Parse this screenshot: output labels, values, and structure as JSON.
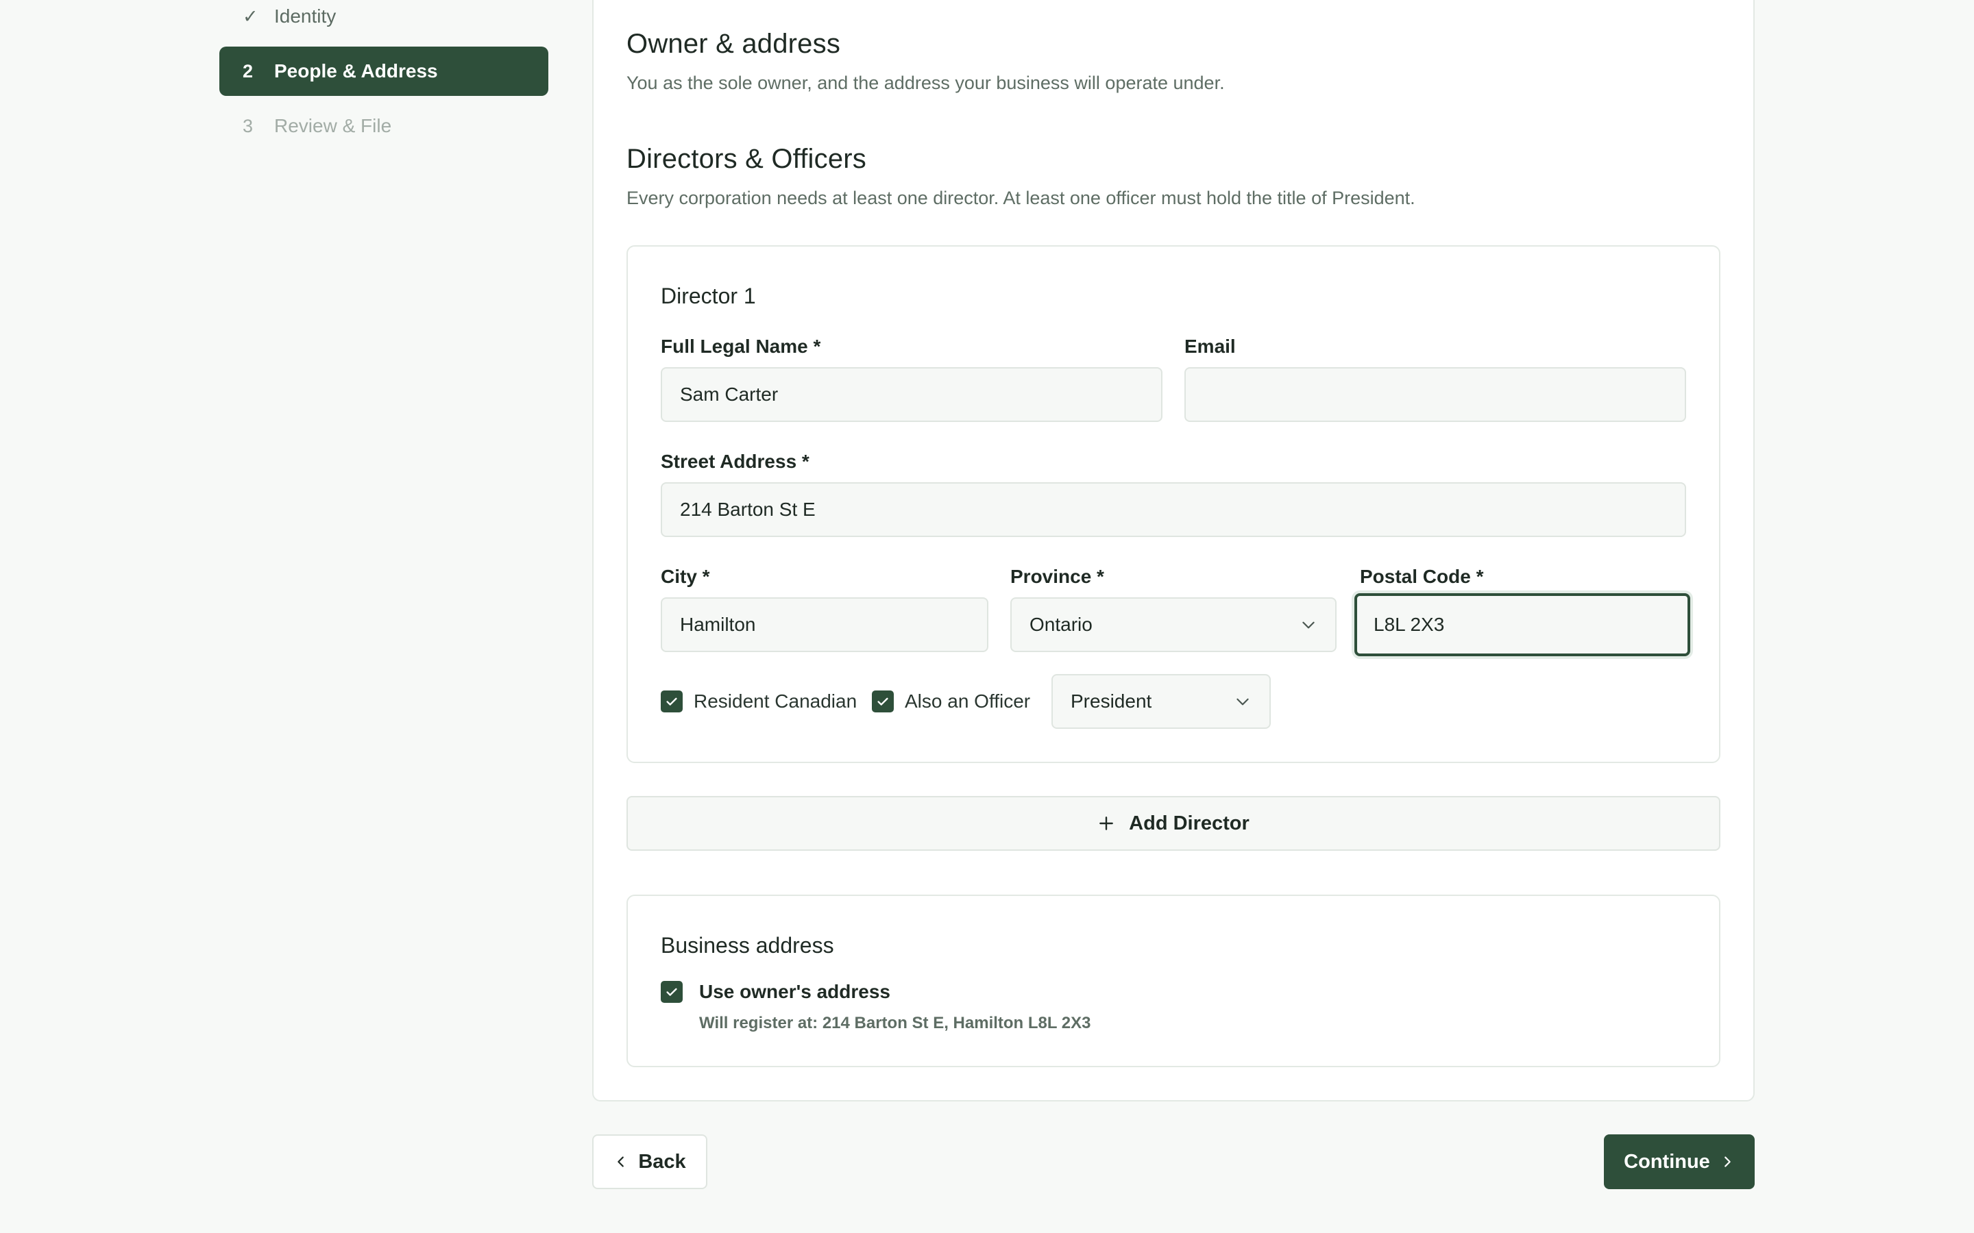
{
  "steps": [
    {
      "marker": "✓",
      "label": "Identity",
      "state": "done"
    },
    {
      "marker": "2",
      "label": "People & Address",
      "state": "active"
    },
    {
      "marker": "3",
      "label": "Review & File",
      "state": "pending"
    }
  ],
  "owner_section": {
    "title": "Owner & address",
    "subtitle": "You as the sole owner, and the address your business will operate under."
  },
  "directors_section": {
    "title": "Directors & Officers",
    "subtitle": "Every corporation needs at least one director. At least one officer must hold the title of President."
  },
  "director": {
    "title": "Director 1",
    "full_name_label": "Full Legal Name *",
    "full_name_value": "Sam Carter",
    "email_label": "Email",
    "email_value": "",
    "street_label": "Street Address *",
    "street_value": "214 Barton St E",
    "city_label": "City *",
    "city_value": "Hamilton",
    "province_label": "Province *",
    "province_value": "Ontario",
    "postal_label": "Postal Code *",
    "postal_value": "L8L 2X3",
    "resident_label": "Resident Canadian",
    "resident_checked": true,
    "officer_label": "Also an Officer",
    "officer_checked": true,
    "officer_title_value": "President"
  },
  "add_director_label": "Add Director",
  "business_address": {
    "title": "Business address",
    "use_owner_label": "Use owner's address",
    "use_owner_checked": true,
    "note": "Will register at: 214 Barton St E, Hamilton L8L 2X3"
  },
  "nav": {
    "back_label": "Back",
    "continue_label": "Continue"
  },
  "colors": {
    "accent": "#2e4f3a",
    "background": "#f7f9f7",
    "muted_text": "#5e6d64"
  }
}
